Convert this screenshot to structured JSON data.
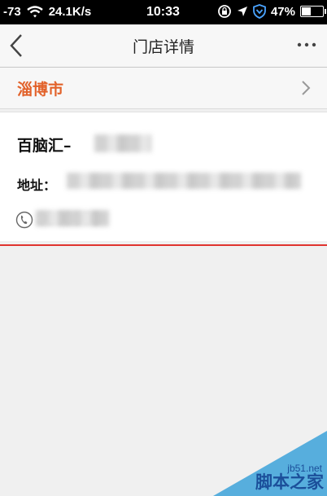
{
  "status_bar": {
    "signal": "-73",
    "network_speed": "24.1K/s",
    "time": "10:33",
    "battery_percent": "47%",
    "battery_level": 0.47
  },
  "nav": {
    "title": "门店详情"
  },
  "city": {
    "label": "淄博市"
  },
  "store": {
    "name_visible": "百脑汇–",
    "address_label": "地址：",
    "phone_visible": "3103555"
  },
  "colors": {
    "accent_orange": "#e2622a",
    "divider_red": "#e0342f",
    "watermark_blue": "#3ca2d9"
  },
  "watermark": {
    "site": "jb51.net",
    "name": "脚本之家"
  }
}
